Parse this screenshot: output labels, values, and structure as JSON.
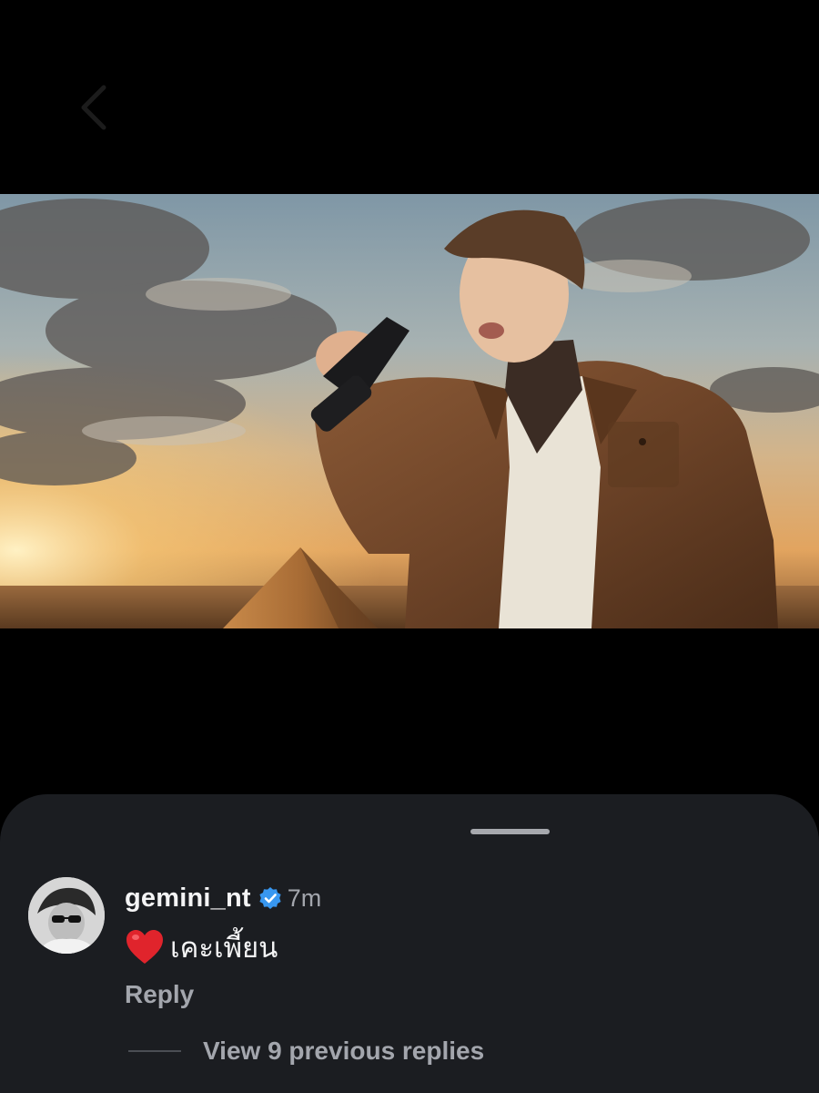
{
  "nav": {
    "back_icon": "chevron-left-icon"
  },
  "media": {
    "kind": "video-still",
    "scene": [
      "sky",
      "clouds",
      "sun",
      "pyramid",
      "man-in-leather-jacket-singing"
    ]
  },
  "comment_sheet": {
    "comment": {
      "username": "gemini_nt",
      "verified": true,
      "timestamp": "7m",
      "emoji_icon": "heart-icon",
      "text": "เคะเพี้ยน",
      "reply_label": "Reply",
      "view_replies_label": "View 9 previous replies"
    }
  },
  "colors": {
    "sheet_background": "#1b1d21",
    "primary_text": "#f4f4f5",
    "secondary_text": "#a3a6ad",
    "verified_badge": "#3897f0",
    "heart": "#e0242c"
  }
}
